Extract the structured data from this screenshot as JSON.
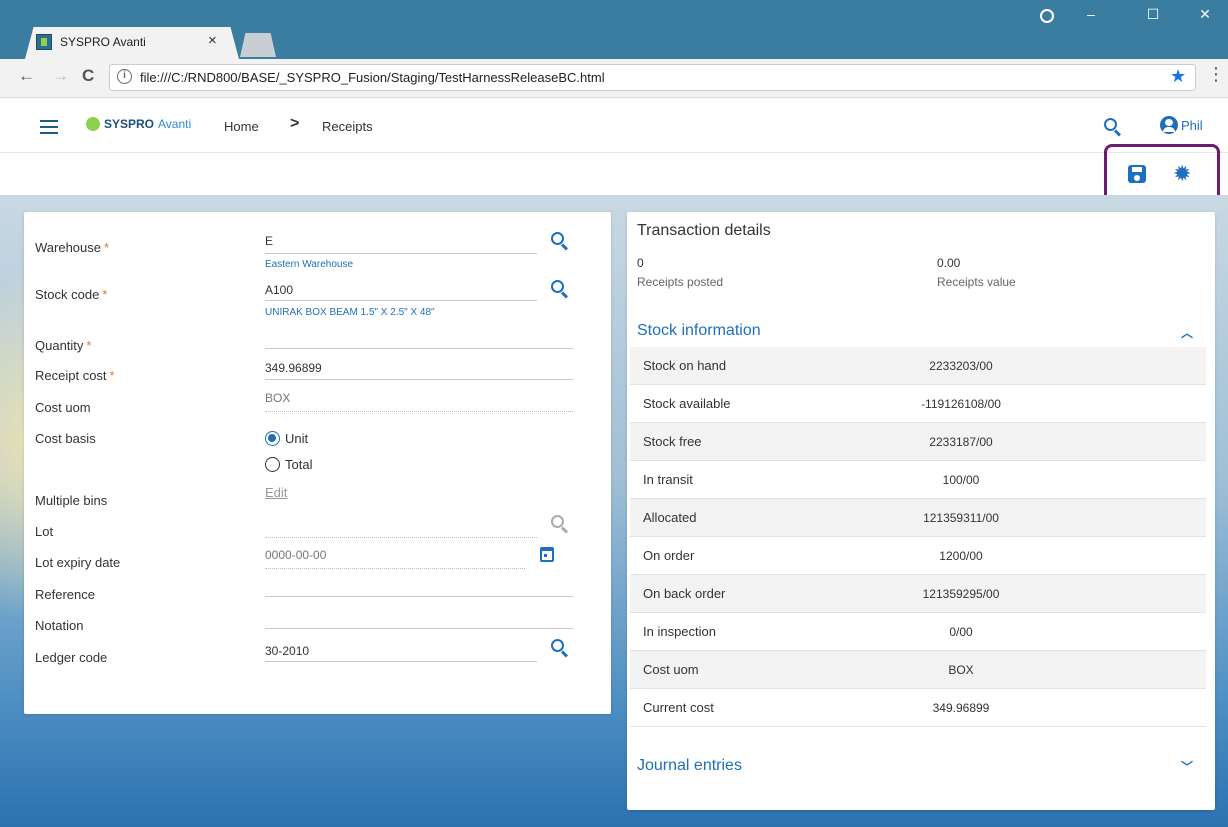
{
  "browser": {
    "tab_title": "SYSPRO Avanti",
    "tab_close": "×",
    "url": "file:///C:/RND800/BASE/_SYSPRO_Fusion/Staging/TestHarnessReleaseBC.html",
    "window_controls": {
      "minimize": "–",
      "maximize": "☐",
      "close": "✕"
    },
    "nav_icons": {
      "back": "←",
      "forward": "→",
      "reload": "C"
    }
  },
  "app": {
    "logo_syspro": "SYSPRO",
    "logo_avanti": "Avanti",
    "breadcrumb": {
      "home": "Home",
      "separator": ">",
      "current": "Receipts"
    },
    "user_name": "Phil"
  },
  "form": {
    "warehouse": {
      "label": "Warehouse",
      "value": "E",
      "description": "Eastern Warehouse",
      "required": "*"
    },
    "stock_code": {
      "label": "Stock code",
      "value": "A100",
      "description": "UNIRAK BOX BEAM 1.5\" X 2.5\" X 48\"",
      "required": "*"
    },
    "quantity": {
      "label": "Quantity",
      "value": "",
      "required": "*"
    },
    "receipt_cost": {
      "label": "Receipt cost",
      "value": "349.96899",
      "required": "*"
    },
    "cost_uom": {
      "label": "Cost uom",
      "value": "BOX"
    },
    "cost_basis": {
      "label": "Cost basis",
      "options": [
        "Unit",
        "Total"
      ],
      "selected": "Unit"
    },
    "multiple_bins": {
      "label": "Multiple bins",
      "link": "Edit"
    },
    "lot": {
      "label": "Lot",
      "value": ""
    },
    "lot_expiry_date": {
      "label": "Lot expiry date",
      "value": "0000-00-00"
    },
    "reference": {
      "label": "Reference",
      "value": ""
    },
    "notation": {
      "label": "Notation",
      "value": ""
    },
    "ledger_code": {
      "label": "Ledger code",
      "value": "30-2010"
    }
  },
  "transaction": {
    "title": "Transaction details",
    "receipts_posted": {
      "value": "0",
      "label": "Receipts posted"
    },
    "receipts_value": {
      "value": "0.00",
      "label": "Receipts value"
    }
  },
  "stock_info": {
    "title": "Stock information",
    "rows": [
      {
        "label": "Stock on hand",
        "value": "2233203/00"
      },
      {
        "label": "Stock available",
        "value": "-119126108/00"
      },
      {
        "label": "Stock free",
        "value": "2233187/00"
      },
      {
        "label": "In transit",
        "value": "100/00"
      },
      {
        "label": "Allocated",
        "value": "121359311/00"
      },
      {
        "label": "On order",
        "value": "1200/00"
      },
      {
        "label": "On back order",
        "value": "121359295/00"
      },
      {
        "label": "In inspection",
        "value": "0/00"
      },
      {
        "label": "Cost uom",
        "value": "BOX"
      },
      {
        "label": "Current cost",
        "value": "349.96899"
      }
    ]
  },
  "journal": {
    "title": "Journal entries"
  },
  "colors": {
    "accent": "#1e6fbd",
    "required": "#e87722",
    "highlight": "#6b1e6e",
    "chrome": "#3a7da0"
  }
}
